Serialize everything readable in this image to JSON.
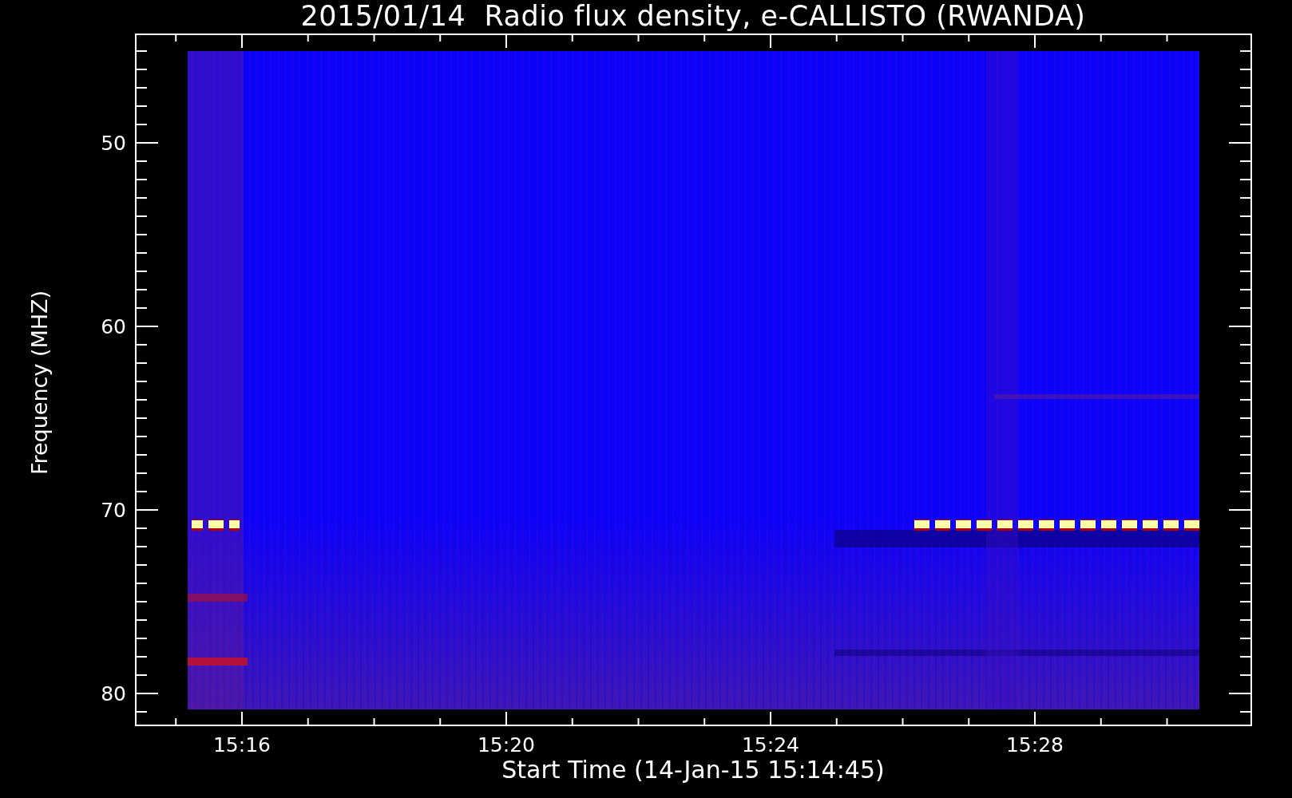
{
  "title": "2015/01/14  Radio flux density, e-CALLISTO (RWANDA)",
  "y_axis": {
    "label": "Frequency (MHZ)",
    "ticks": [
      "50",
      "60",
      "70",
      "80"
    ]
  },
  "x_axis": {
    "label": "Start Time (14-Jan-15 15:14:45)",
    "ticks": [
      "15:16",
      "15:20",
      "15:24",
      "15:28"
    ]
  }
}
